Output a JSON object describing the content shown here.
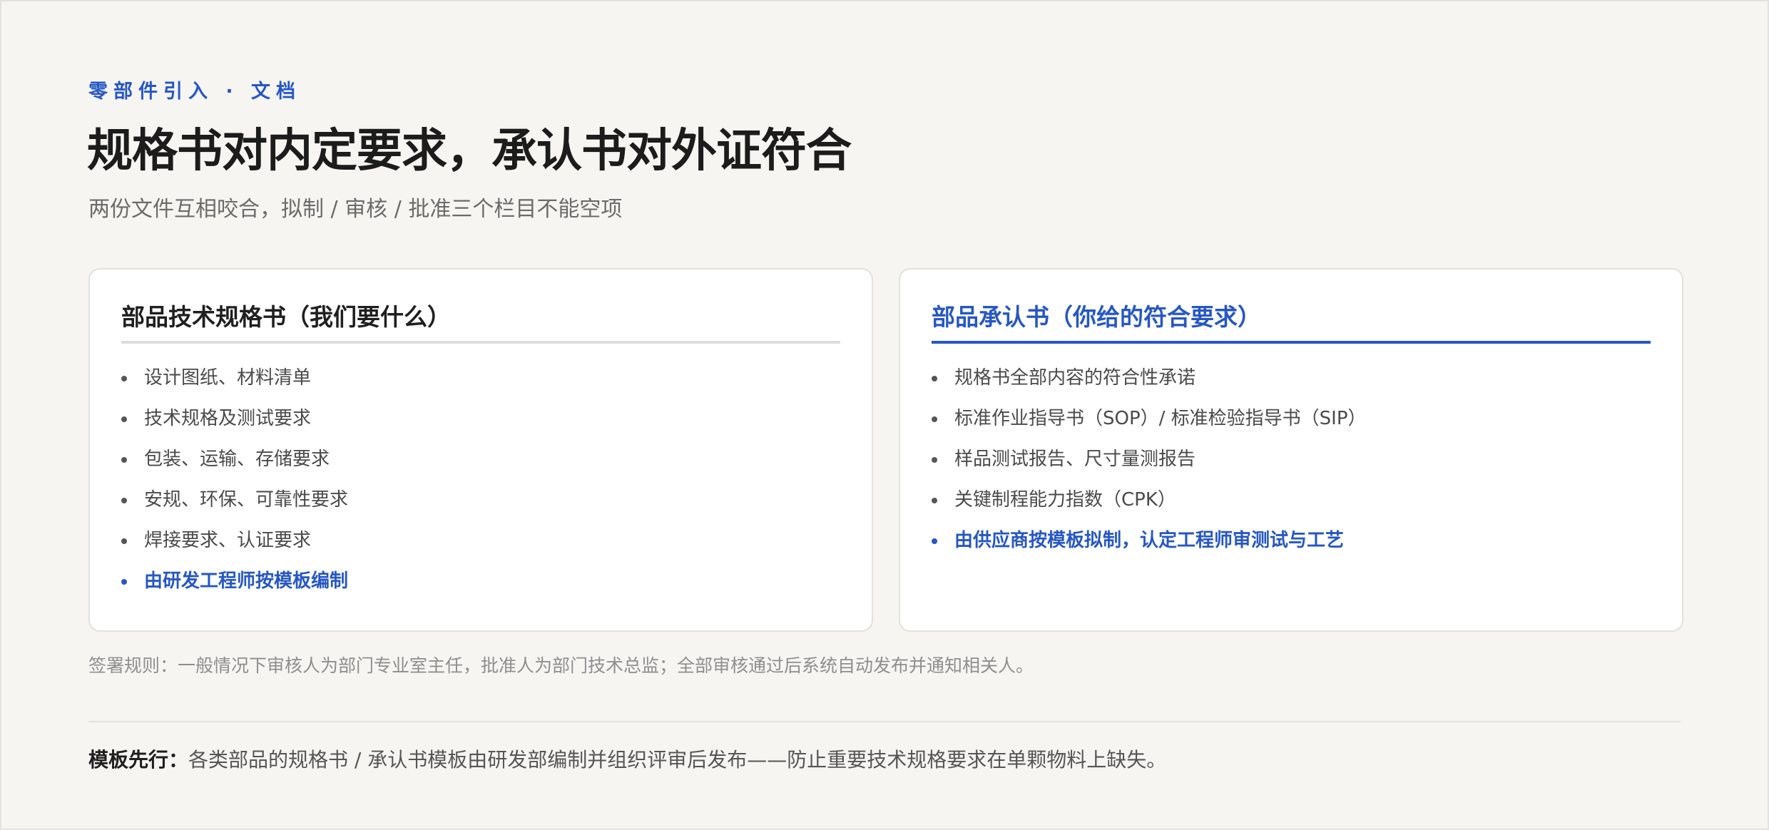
{
  "header": {
    "eyebrow": "零部件引入 · 文档",
    "title": "规格书对内定要求，承认书对外证符合",
    "subtitle": "两份文件互相咬合，拟制 / 审核 / 批准三个栏目不能空项"
  },
  "cards": [
    {
      "title": "部品技术规格书（我们要什么）",
      "items": [
        "设计图纸、材料清单",
        "技术规格及测试要求",
        "包装、运输、存储要求",
        "安规、环保、可靠性要求",
        "焊接要求、认证要求",
        "由研发工程师按模板编制"
      ]
    },
    {
      "title": "部品承认书（你给的符合要求）",
      "items": [
        "规格书全部内容的符合性承诺",
        "标准作业指导书（SOP）/ 标准检验指导书（SIP）",
        "样品测试报告、尺寸量测报告",
        "关键制程能力指数（CPK）",
        "由供应商按模板拟制，认定工程师审测试与工艺"
      ]
    }
  ],
  "sign_rule": "签署规则：一般情况下审核人为部门专业室主任，批准人为部门技术总监；全部审核通过后系统自动发布并通知相关人。",
  "footnote": {
    "lead": "模板先行：",
    "text": "各类部品的规格书 / 承认书模板由研发部编制并组织评审后发布——防止重要技术规格要求在单颗物料上缺失。"
  },
  "colors": {
    "accent": "#2757c5",
    "background": "#f6f5f2",
    "card": "#ffffff",
    "text": "#222222",
    "muted": "#8e8e8e"
  }
}
